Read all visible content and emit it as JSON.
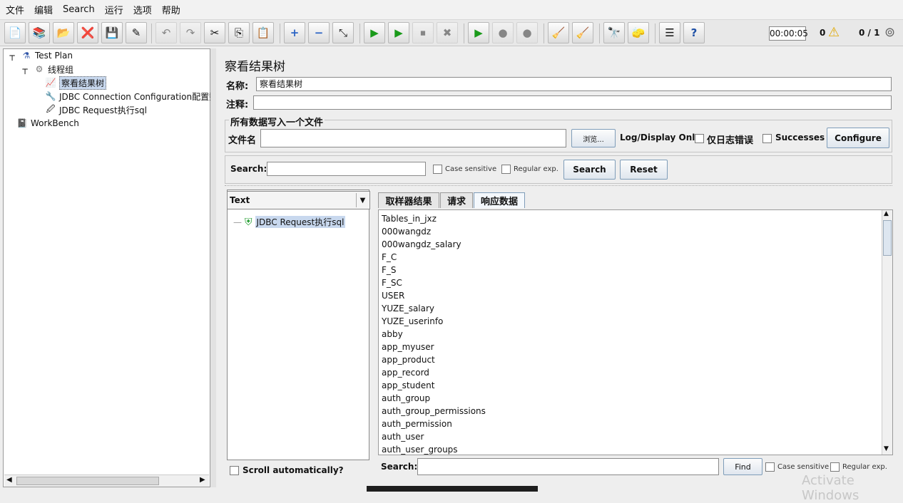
{
  "menu": [
    "文件",
    "编辑",
    "Search",
    "运行",
    "选项",
    "帮助"
  ],
  "toolbar": {
    "timer": "00:00:05",
    "warn_count": "0",
    "threads": "0 / 1"
  },
  "tree": {
    "test_plan": "Test Plan",
    "thread_group": "线程组",
    "result_tree": "察看结果树",
    "jdbc_config": "JDBC Connection Configuration配置数",
    "jdbc_request": "JDBC Request执行sql",
    "workbench": "WorkBench"
  },
  "panel": {
    "title": "察看结果树",
    "name_label": "名称:",
    "name_value": "察看结果树",
    "comment_label": "注释:",
    "comment_value": "",
    "file_group_title": "所有数据写入一个文件",
    "filename_label": "文件名",
    "filename_value": "",
    "browse_label": "浏览...",
    "log_display_label": "Log/Display Only:",
    "errors_only_label": "仅日志错误",
    "successes_label": "Successes",
    "configure_label": "Configure"
  },
  "search": {
    "label": "Search:",
    "value": "",
    "case_sensitive": "Case sensitive",
    "regular_exp": "Regular exp.",
    "search_button": "Search",
    "reset_button": "Reset"
  },
  "results": {
    "renderer": "Text",
    "items": [
      "JDBC Request执行sql"
    ],
    "scroll_auto_label": "Scroll automatically?"
  },
  "tabs": [
    "取样器结果",
    "请求",
    "响应数据"
  ],
  "response_lines": [
    "Tables_in_jxz",
    "000wangdz",
    "000wangdz_salary",
    "F_C",
    "F_S",
    "F_SC",
    "USER",
    "YUZE_salary",
    "YUZE_userinfo",
    "abby",
    "app_myuser",
    "app_product",
    "app_record",
    "app_student",
    "auth_group",
    "auth_group_permissions",
    "auth_permission",
    "auth_user",
    "auth_user_groups"
  ],
  "find_bar": {
    "label": "Search:",
    "value": "",
    "find_button": "Find",
    "case_sensitive": "Case sensitive",
    "regular_exp": "Regular exp."
  },
  "watermark": "Activate Windows"
}
